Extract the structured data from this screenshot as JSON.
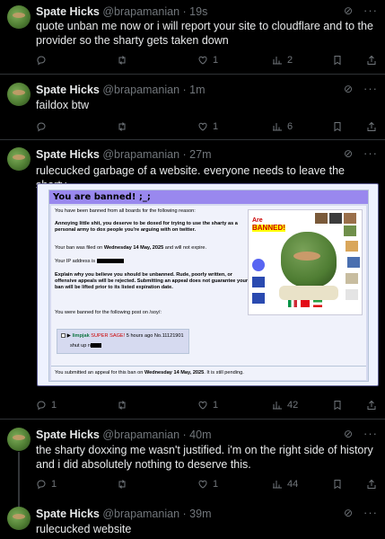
{
  "tweets": [
    {
      "name": "Spate Hicks",
      "handle": "@brapamanian",
      "time": "19s",
      "text": "quote unban me now or i will report your site to cloudflare and to the provider so the sharty gets taken down",
      "replies": "",
      "retweets": "",
      "likes": "1",
      "views": "2"
    },
    {
      "name": "Spate Hicks",
      "handle": "@brapamanian",
      "time": "1m",
      "text": "faildox btw",
      "replies": "",
      "retweets": "",
      "likes": "1",
      "views": "6"
    },
    {
      "name": "Spate Hicks",
      "handle": "@brapamanian",
      "time": "27m",
      "text": "rulecucked garbage of a website. everyone needs to leave the sharty.",
      "replies": "1",
      "retweets": "",
      "likes": "1",
      "views": "42"
    },
    {
      "name": "Spate Hicks",
      "handle": "@brapamanian",
      "time": "40m",
      "text": "the sharty doxxing me wasn't justified. i'm on the right side of history and i did absolutely nothing to deserve this.",
      "replies": "1",
      "retweets": "",
      "likes": "1",
      "views": "44"
    },
    {
      "name": "Spate Hicks",
      "handle": "@brapamanian",
      "time": "39m",
      "text": "rulecucked website"
    }
  ],
  "separator": "·",
  "ban_page": {
    "title": "You are banned! ;_;",
    "intro": "You have been banned from all boards for the following reason:",
    "reason": "Annoying little shit, you deserve to be doxed for trying to use the sharty as a personal army to dox people you're arguing with on twitter.",
    "filed_prefix": "Your ban was filed on ",
    "filed_date": "Wednesday 14 May, 2025",
    "filed_suffix": " and will not expire.",
    "ip_label": "Your IP address is",
    "explain": "Explain why you believe you should be unbanned. Rude, poorly written, or offensive appeals will be rejected. Submitting an appeal does not guarantee your ban will be lifted prior to its listed expiration date.",
    "post_intro": "You were banned for the following post on /soy/:",
    "post_name": "limpjak",
    "post_sage": "SUPER SAGE!",
    "post_time": "5 hours ago No.11121901",
    "post_text": "shut up n",
    "appeal_prefix": "You submitted an appeal for this ban on ",
    "appeal_date": "Wednesday 14 May, 2025",
    "appeal_suffix": ". It is still pending.",
    "image_are": "Are",
    "image_banned": "BANNED!"
  },
  "colors": {
    "background": "#000000",
    "text": "#e7e9ea",
    "muted": "#71767b",
    "divider": "#2f3336",
    "ban_header": "#9988ee"
  }
}
